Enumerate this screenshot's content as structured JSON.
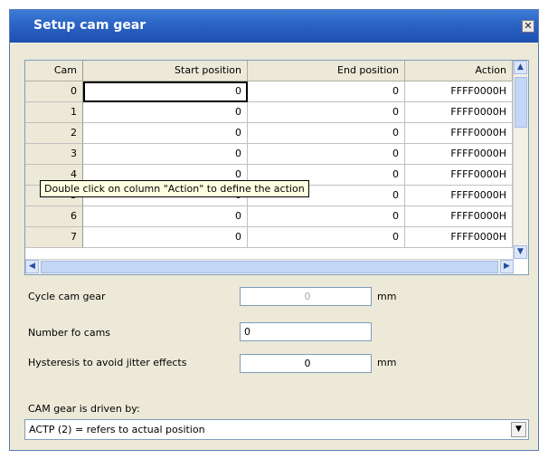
{
  "window": {
    "title": "Setup cam gear",
    "close_glyph": "✕"
  },
  "grid": {
    "columns": [
      "Cam",
      "Start position",
      "End position",
      "Action"
    ],
    "rows": [
      {
        "cam": "0",
        "start": "0",
        "end": "0",
        "action": "FFFF0000H"
      },
      {
        "cam": "1",
        "start": "0",
        "end": "0",
        "action": "FFFF0000H"
      },
      {
        "cam": "2",
        "start": "0",
        "end": "0",
        "action": "FFFF0000H"
      },
      {
        "cam": "3",
        "start": "0",
        "end": "0",
        "action": "FFFF0000H"
      },
      {
        "cam": "4",
        "start": "0",
        "end": "0",
        "action": "FFFF0000H"
      },
      {
        "cam": "5",
        "start": "0",
        "end": "0",
        "action": "FFFF0000H"
      },
      {
        "cam": "6",
        "start": "0",
        "end": "0",
        "action": "FFFF0000H"
      },
      {
        "cam": "7",
        "start": "0",
        "end": "0",
        "action": "FFFF0000H"
      }
    ],
    "tooltip": "Double click on column \"Action\" to define the action",
    "scroll_up": "▲",
    "scroll_down": "▼",
    "scroll_left": "◀",
    "scroll_right": "▶"
  },
  "form": {
    "cycle_label": "Cycle cam gear",
    "cycle_value": "0",
    "cycle_unit": "mm",
    "number_label": "Number fo cams",
    "number_value": "0",
    "hysteresis_label": "Hysteresis to avoid jitter effects",
    "hysteresis_value": "0",
    "hysteresis_unit": "mm",
    "driven_label": "CAM gear is driven by:",
    "driven_value": "ACTP (2) = refers to actual position",
    "dropdown_arrow": "▼"
  }
}
